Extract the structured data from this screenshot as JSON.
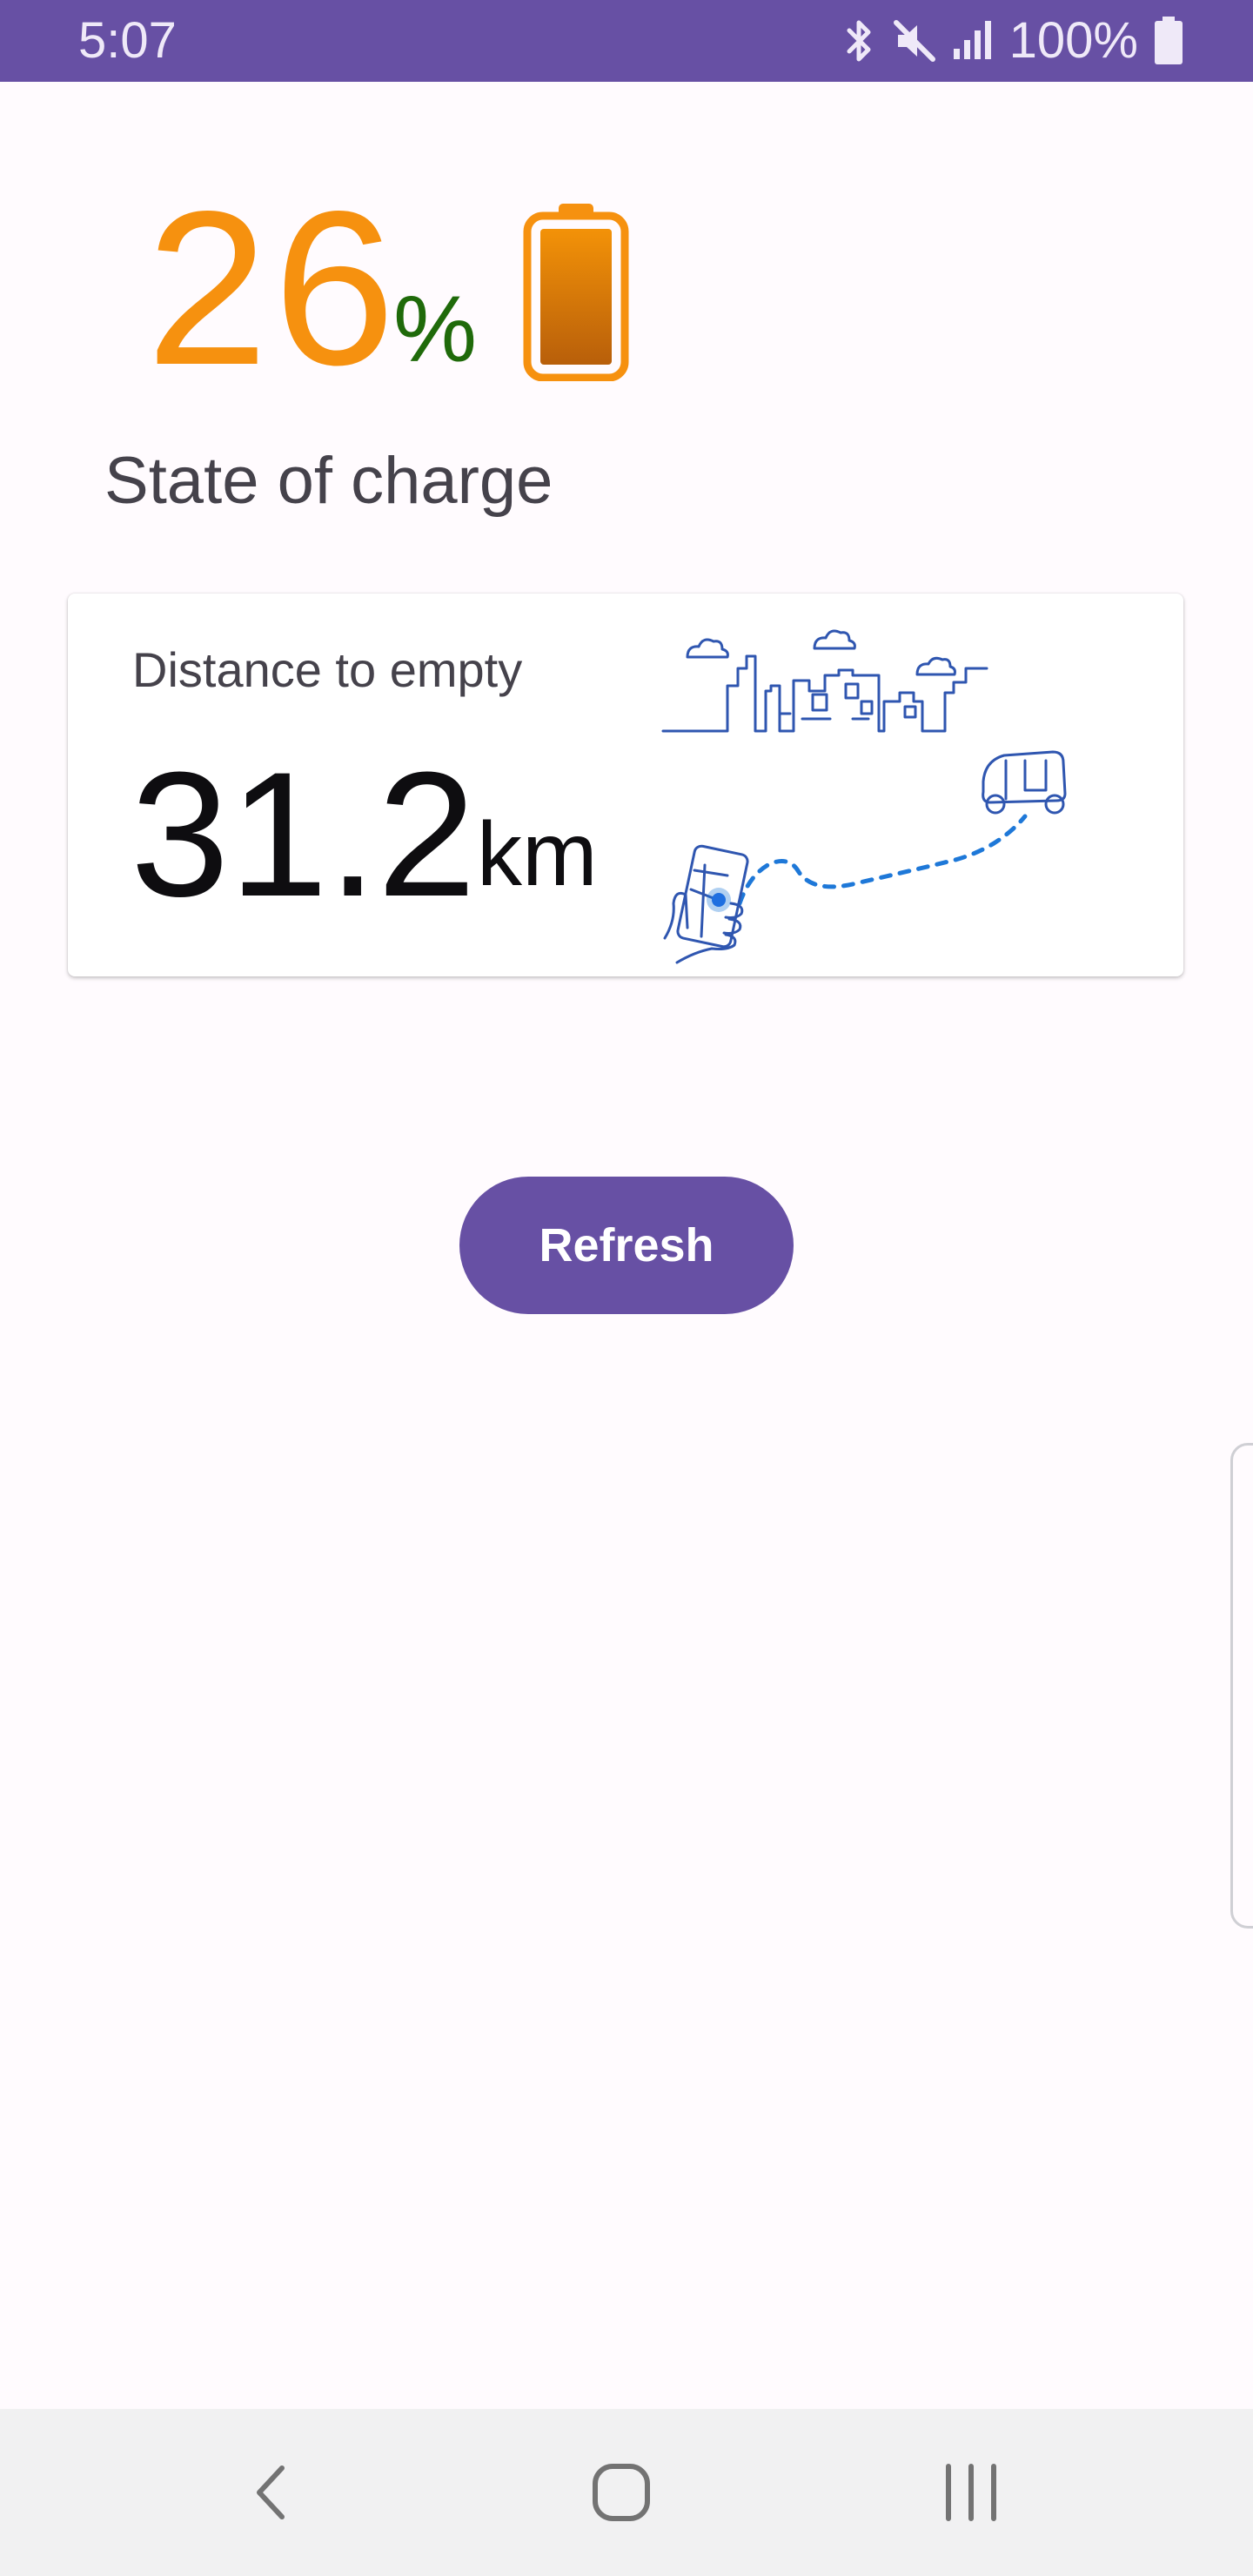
{
  "status_bar": {
    "time": "5:07",
    "battery_percent": "100%",
    "icons": [
      "bluetooth-icon",
      "mute-icon",
      "signal-icon",
      "battery-icon"
    ],
    "background_color": "#6750a4"
  },
  "charge": {
    "value": "26",
    "unit": "%",
    "label": "State of charge",
    "value_color": "#f6910f",
    "unit_color": "#1f6a0a",
    "battery_icon": "battery-full-icon"
  },
  "distance_card": {
    "title": "Distance to empty",
    "value": "31.2",
    "unit": "km",
    "illustration": "city-route-rickshaw-illustration"
  },
  "actions": {
    "refresh_label": "Refresh",
    "accent_color": "#6750a4"
  },
  "navigation": {
    "buttons": [
      "back-icon",
      "home-icon",
      "recents-icon"
    ]
  }
}
